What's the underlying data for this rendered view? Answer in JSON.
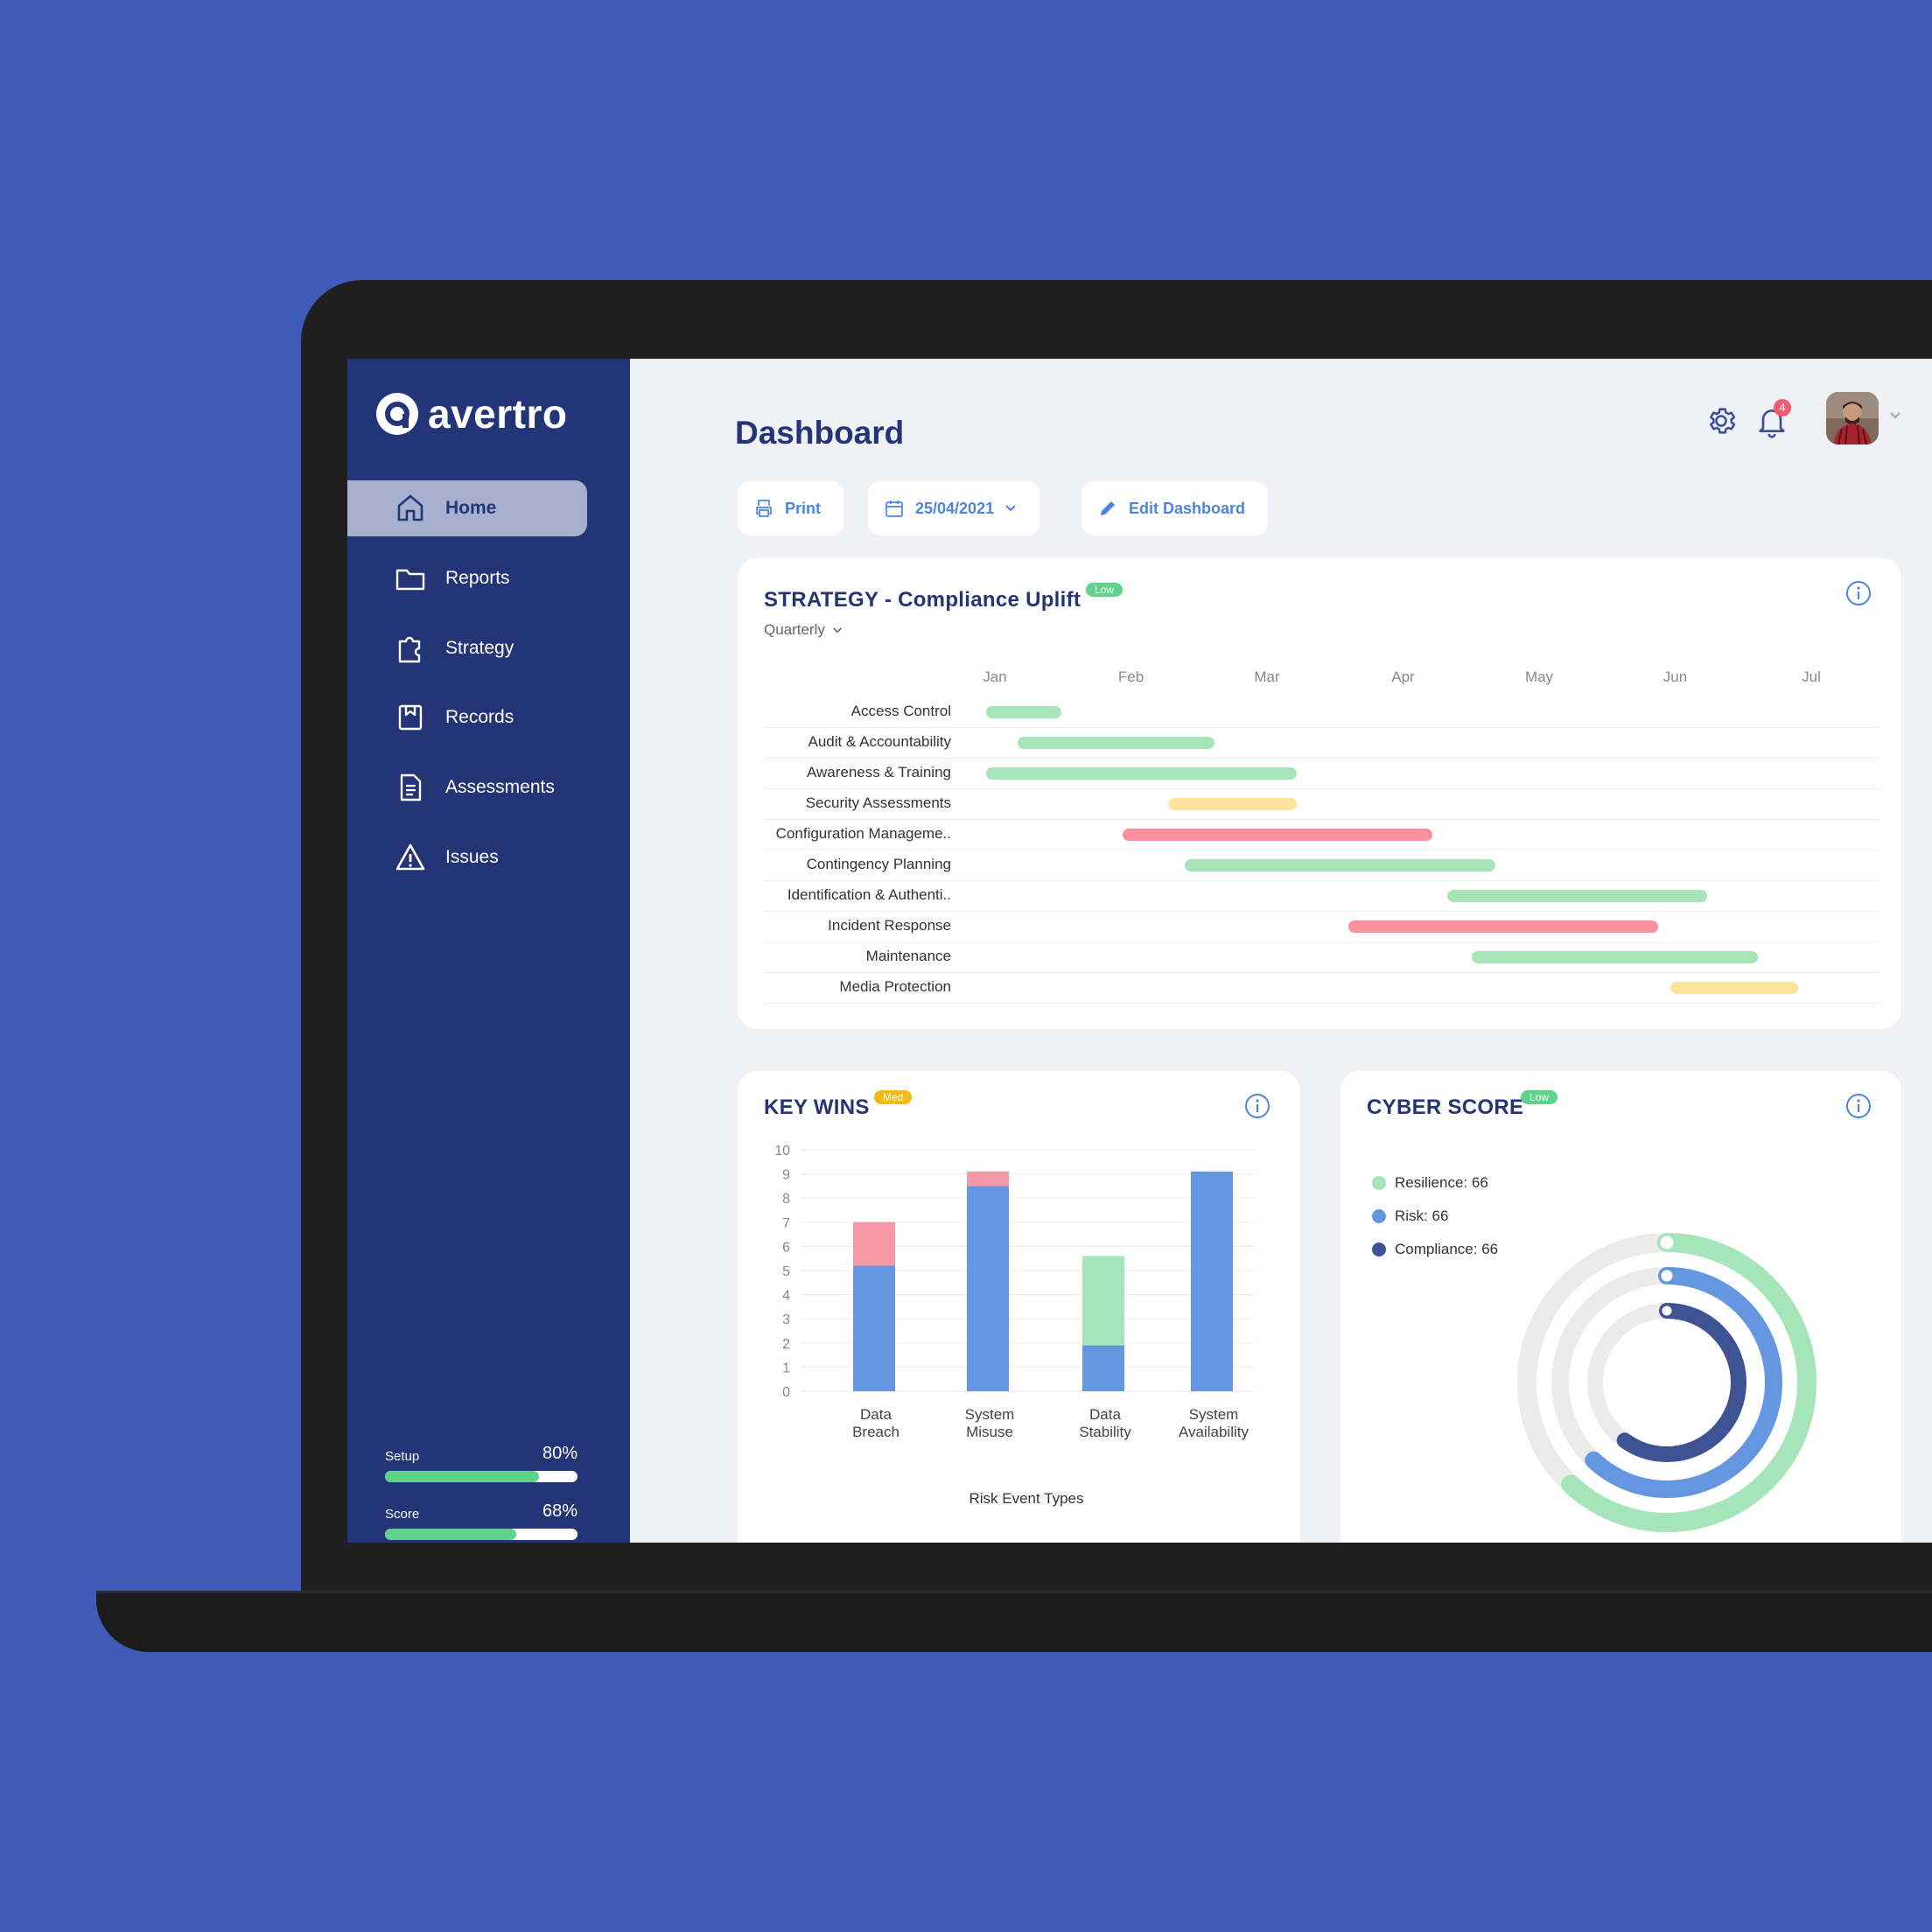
{
  "brand": {
    "name": "avertro"
  },
  "sidebar": {
    "items": [
      {
        "label": "Home",
        "active": true,
        "icon": "home-icon"
      },
      {
        "label": "Reports",
        "active": false,
        "icon": "folder-icon"
      },
      {
        "label": "Strategy",
        "active": false,
        "icon": "puzzle-icon"
      },
      {
        "label": "Records",
        "active": false,
        "icon": "bookmark-icon"
      },
      {
        "label": "Assessments",
        "active": false,
        "icon": "document-icon"
      },
      {
        "label": "Issues",
        "active": false,
        "icon": "warning-icon"
      }
    ],
    "setup": {
      "label": "Setup",
      "value_text": "80%",
      "value": 0.8
    },
    "score": {
      "label": "Score",
      "value_text": "68%",
      "value": 0.68
    }
  },
  "header": {
    "title": "Dashboard",
    "notifications_count": "4",
    "icons": [
      "gear-icon",
      "bell-icon",
      "avatar",
      "chevron-down-icon"
    ]
  },
  "toolbar": {
    "print_label": "Print",
    "date_label": "25/04/2021",
    "edit_label": "Edit Dashboard"
  },
  "colors": {
    "navy": "#243577",
    "accent_blue": "#4d84e0",
    "green": "#a6e5b9",
    "yellow": "#fde49a",
    "red": "#fb909d",
    "bar_blue": "#6497e0",
    "bar_pink": "#f898a6",
    "bar_green": "#a6e5b9",
    "compliance": "#3e5393"
  },
  "strategy": {
    "title": "STRATEGY - Compliance Uplift",
    "badge": "Low",
    "period": "Quarterly",
    "months": [
      "Jan",
      "Feb",
      "Mar",
      "Apr",
      "May",
      "Jun",
      "Jul"
    ],
    "rows": [
      {
        "label": "Access Control",
        "start": 0.0,
        "end": 0.55,
        "color": "green"
      },
      {
        "label": "Audit & Accountability",
        "start": 0.23,
        "end": 1.68,
        "color": "green"
      },
      {
        "label": "Awareness & Training",
        "start": 0.0,
        "end": 2.28,
        "color": "green"
      },
      {
        "label": "Security Assessments",
        "start": 1.34,
        "end": 2.28,
        "color": "yellow"
      },
      {
        "label": "Configuration Manageme..",
        "start": 1.0,
        "end": 3.28,
        "color": "red"
      },
      {
        "label": "Contingency Planning",
        "start": 1.46,
        "end": 3.74,
        "color": "green"
      },
      {
        "label": "Identification & Authenti..",
        "start": 3.39,
        "end": 5.3,
        "color": "green"
      },
      {
        "label": "Incident Response",
        "start": 2.66,
        "end": 4.94,
        "color": "red"
      },
      {
        "label": "Maintenance",
        "start": 3.57,
        "end": 5.67,
        "color": "green"
      },
      {
        "label": "Media Protection",
        "start": 5.03,
        "end": 5.97,
        "color": "yellow"
      }
    ]
  },
  "key_wins": {
    "title": "KEY WINS",
    "badge": "Med"
  },
  "chart_data": {
    "type": "bar",
    "stacked": true,
    "categories": [
      [
        "Data",
        "Breach"
      ],
      [
        "System",
        "Misuse"
      ],
      [
        "Data",
        "Stability"
      ],
      [
        "System",
        "Availability"
      ]
    ],
    "series": [
      {
        "color": "#6497e0",
        "values": [
          5.2,
          8.5,
          1.9,
          9.1
        ]
      },
      {
        "color": "#f898a6",
        "values": [
          1.8,
          0.6,
          0,
          0
        ]
      },
      {
        "color": "#a6e5b9",
        "values": [
          0,
          0,
          3.7,
          0
        ]
      }
    ],
    "xlabel": "Risk Event Types",
    "ylabel": "",
    "ylim": [
      0,
      10
    ],
    "yticks": [
      0,
      1,
      2,
      3,
      4,
      5,
      6,
      7,
      8,
      9,
      10
    ],
    "grid": true
  },
  "cyber_score": {
    "title": "CYBER SCORE",
    "badge": "Low",
    "legend": [
      {
        "label": "Resilience: 66",
        "color": "#a6e5b9",
        "value": 0.62
      },
      {
        "label": "Risk: 66",
        "color": "#6497e0",
        "value": 0.62
      },
      {
        "label": "Compliance: 66",
        "color": "#3e5393",
        "value": 0.6
      }
    ]
  }
}
